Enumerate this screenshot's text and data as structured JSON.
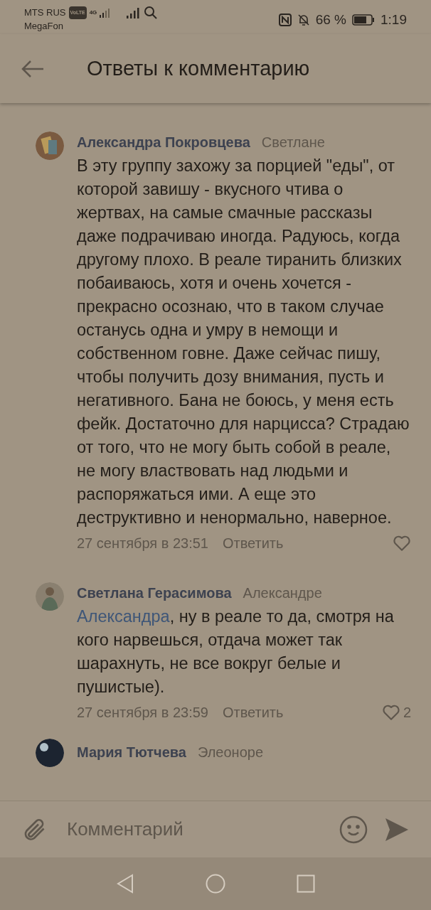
{
  "status_bar": {
    "carrier": "MTS RUS",
    "volte": "VoLTE",
    "network": "4G",
    "carrier_2": "MegaFon",
    "battery": "66 %",
    "time": "1:19"
  },
  "header": {
    "title": "Ответы к комментарию"
  },
  "comments": [
    {
      "kind": "full",
      "author": "Александра Покровцева",
      "addressee": "Светлане",
      "text": "В эту группу захожу за порцией \"еды\", от которой завишу - вкусного чтива о жертвах, на самые смачные рассказы даже подрачиваю иногда. Радуюсь, когда другому плохо. В реале тиранить близких побаиваюсь, хотя и очень хочется - прекрасно осознаю, что в таком случае останусь одна и умру в немощи и собственном говне. Даже сейчас пишу, чтобы получить дозу внимания, пусть и негативного. Бана не боюсь, у меня есть фейк. Достаточно для нарцисса? Страдаю от того, что не могу быть собой в реале, не могу властвовать над людьми и распоряжаться ими. А еще это деструктивно и ненормально, наверное.",
      "date": "27 сентября в 23:51",
      "reply": "Ответить"
    },
    {
      "kind": "full",
      "author": "Светлана Герасимова",
      "addressee": "Александре",
      "mention": "Александра",
      "text": ", ну в реале то да, смотря на кого нарвешься, отдача может так шарахнуть, не все вокруг белые и пушистые).",
      "date": "27 сентября в 23:59",
      "reply": "Ответить",
      "likes": "2"
    },
    {
      "kind": "cut_bottom",
      "author": "Мария Тютчева",
      "addressee": "Элеоноре"
    }
  ],
  "composer": {
    "placeholder": "Комментарий"
  }
}
